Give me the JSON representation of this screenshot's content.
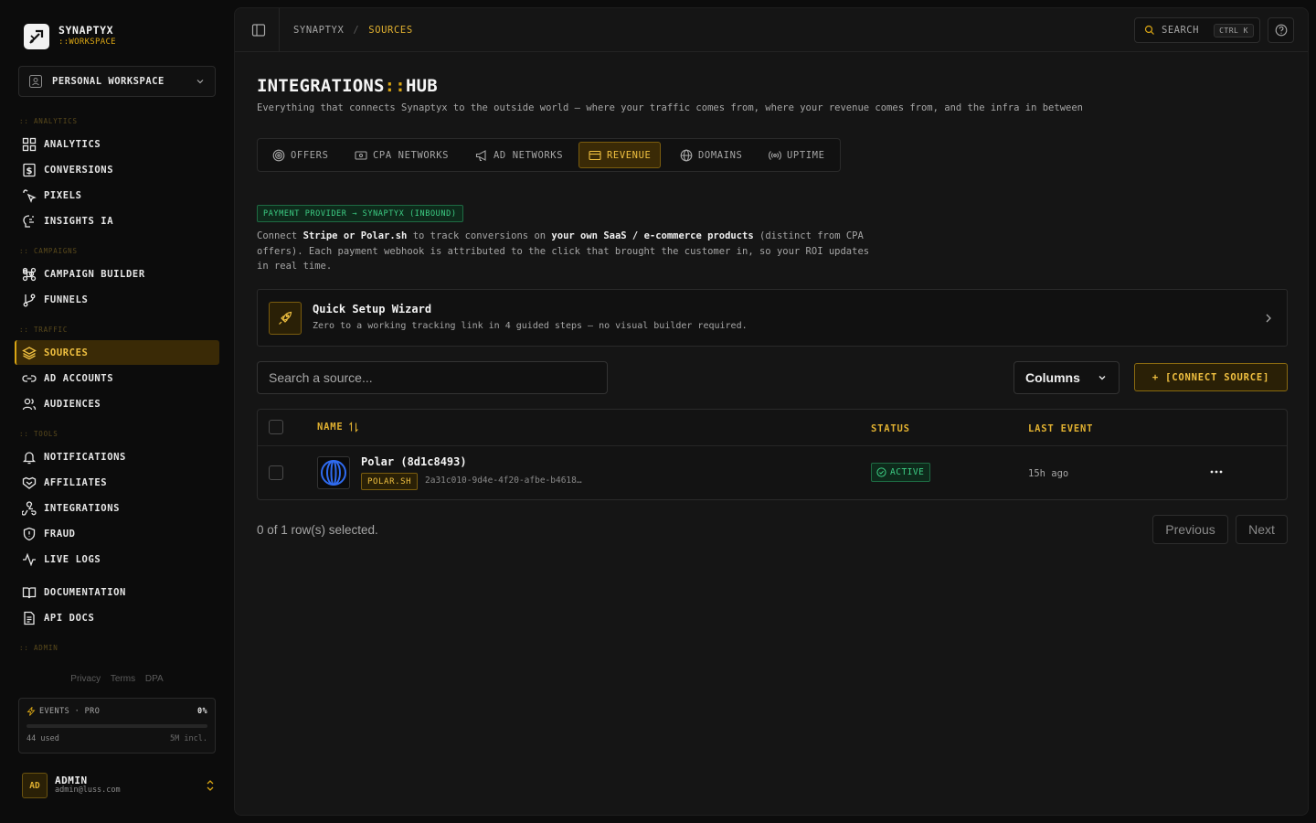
{
  "brand": {
    "name": "SYNAPTYX",
    "sub": "::WORKSPACE"
  },
  "workspace": {
    "label": "PERSONAL WORKSPACE"
  },
  "sidebar": {
    "sections": [
      "ANALYTICS",
      "CAMPAIGNS",
      "TRAFFIC",
      "TOOLS",
      "ADMIN"
    ],
    "section_prefix": ":: ",
    "items": [
      {
        "label": "ANALYTICS",
        "icon": "dashboard-icon"
      },
      {
        "label": "CONVERSIONS",
        "icon": "dollar-receipt-icon"
      },
      {
        "label": "PIXELS",
        "icon": "pointer-click-icon"
      },
      {
        "label": "INSIGHTS IA",
        "icon": "brain-icon"
      },
      {
        "label": "CAMPAIGN BUILDER",
        "icon": "command-icon"
      },
      {
        "label": "FUNNELS",
        "icon": "git-branch-icon"
      },
      {
        "label": "SOURCES",
        "icon": "layers-icon",
        "active": true
      },
      {
        "label": "AD ACCOUNTS",
        "icon": "link-icon"
      },
      {
        "label": "AUDIENCES",
        "icon": "users-icon"
      },
      {
        "label": "NOTIFICATIONS",
        "icon": "bell-icon"
      },
      {
        "label": "AFFILIATES",
        "icon": "handshake-icon"
      },
      {
        "label": "INTEGRATIONS",
        "icon": "webhook-icon"
      },
      {
        "label": "FRAUD",
        "icon": "shield-alert-icon"
      },
      {
        "label": "LIVE LOGS",
        "icon": "activity-icon"
      },
      {
        "label": "DOCUMENTATION",
        "icon": "book-icon"
      },
      {
        "label": "API DOCS",
        "icon": "file-text-icon"
      }
    ],
    "legal": [
      "Privacy",
      "Terms",
      "DPA"
    ]
  },
  "usage": {
    "label": "EVENTS · PRO",
    "percent_label": "0%",
    "fill_fraction": 0.0,
    "used": "44 used",
    "included": "5M incl."
  },
  "user": {
    "initials": "AD",
    "name": "ADMIN",
    "email": "admin@luss.com"
  },
  "topbar": {
    "crumb_root": "SYNAPTYX",
    "crumb_sep": "/",
    "crumb_current": "SOURCES",
    "search_label": "SEARCH",
    "search_kbd": "CTRL K"
  },
  "page": {
    "title_a": "INTEGRATIONS",
    "title_sep": "::",
    "title_b": "HUB",
    "subtitle": "Everything that connects Synaptyx to the outside world — where your traffic comes from, where your revenue comes from, and the infra in between"
  },
  "tabs": [
    {
      "label": "OFFERS",
      "icon": "target-icon"
    },
    {
      "label": "CPA NETWORKS",
      "icon": "dollar-card-icon"
    },
    {
      "label": "AD NETWORKS",
      "icon": "megaphone-icon"
    },
    {
      "label": "REVENUE",
      "icon": "credit-card-icon",
      "active": true
    },
    {
      "label": "DOMAINS",
      "icon": "globe-icon"
    },
    {
      "label": "UPTIME",
      "icon": "radio-icon"
    }
  ],
  "revenue": {
    "badge": "PAYMENT PROVIDER → SYNAPTYX (INBOUND)",
    "desc_1": "Connect ",
    "desc_2": "Stripe or Polar.sh",
    "desc_3": " to track conversions on ",
    "desc_4": "your own SaaS / e-commerce products",
    "desc_5": " (distinct from CPA offers). Each payment webhook is attributed to the click that brought the customer in, so your ROI updates in real time."
  },
  "wizard": {
    "title": "Quick Setup Wizard",
    "subtitle": "Zero to a working tracking link in 4 guided steps — no visual builder required."
  },
  "toolbar": {
    "search_placeholder": "Search a source...",
    "columns_label": "Columns",
    "connect_label": "+ [CONNECT SOURCE]"
  },
  "table": {
    "headers": {
      "name": "NAME",
      "status": "STATUS",
      "last_event": "LAST EVENT"
    },
    "rows": [
      {
        "name": "Polar (8d1c8493)",
        "provider": "POLAR.SH",
        "id": "2a31c010-9d4e-4f20-afbe-b4618…",
        "status": "ACTIVE",
        "last_event": "15h ago"
      }
    ]
  },
  "footer": {
    "selected": "0 of 1 row(s) selected.",
    "previous": "Previous",
    "next": "Next"
  },
  "colors": {
    "accent": "#d9a514",
    "success": "#3dcf85",
    "bg": "#0c0c0c",
    "panel": "#151515"
  }
}
